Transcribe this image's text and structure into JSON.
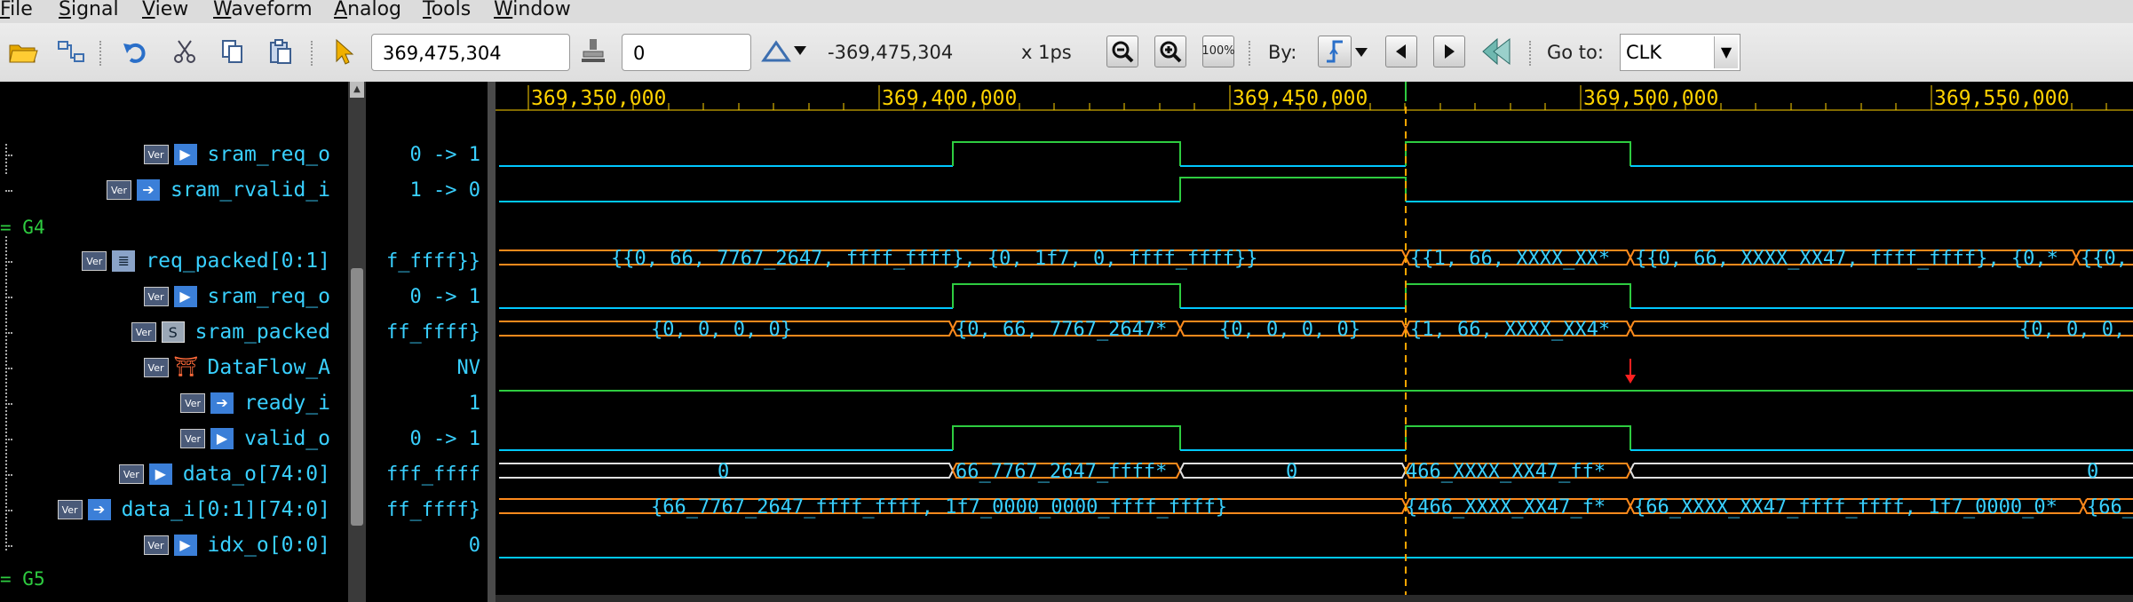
{
  "menu": [
    "File",
    "Signal",
    "View",
    "Waveform",
    "Analog",
    "Tools",
    "Window"
  ],
  "toolbar": {
    "cursor_time": "369,475,304",
    "delta_time": "0",
    "delta_readout": "-369,475,304",
    "scale": "x 1ps",
    "zoom_100": "100%",
    "by_label": "By:",
    "goto_label": "Go to:",
    "goto_value": "CLK"
  },
  "groups": [
    "G4",
    "G5"
  ],
  "signals": [
    {
      "name": "sram_req_o",
      "kind": "out",
      "value": "0 -> 1"
    },
    {
      "name": "sram_rvalid_i",
      "kind": "in",
      "value": "1 -> 0"
    },
    {
      "name": "req_packed[0:1]",
      "kind": "struct",
      "value": "f_ffff}}"
    },
    {
      "name": "sram_req_o",
      "kind": "out",
      "value": "0 -> 1"
    },
    {
      "name": "sram_packed",
      "kind": "s",
      "value": "ff_ffff}"
    },
    {
      "name": "DataFlow_A",
      "kind": "flow",
      "value": "NV"
    },
    {
      "name": "ready_i",
      "kind": "in",
      "value": "1"
    },
    {
      "name": "valid_o",
      "kind": "out",
      "value": "0 -> 1"
    },
    {
      "name": "data_o[74:0]",
      "kind": "out",
      "value": "fff_ffff"
    },
    {
      "name": "data_i[0:1][74:0]",
      "kind": "in",
      "value": "ff_ffff}"
    },
    {
      "name": "idx_o[0:0]",
      "kind": "out",
      "value": "0"
    }
  ],
  "ruler": [
    "369,350,000",
    "369,400,000",
    "369,450,000",
    "369,500,000",
    "369,550,000"
  ],
  "bus_text": {
    "req_packed": [
      "{{0, 66, 7767_2647, ffff_ffff}, {0, 1f7, 0, ffff_ffff}}",
      "{{1, 66, XXXX_XX*",
      "{{0, 66, XXXX_XX47, ffff_ffff}, {0,*",
      "{{0,"
    ],
    "sram_packed": [
      "{0, 0, 0, 0}",
      "{0, 66, 7767_2647*",
      "{0, 0, 0, 0}",
      "{1, 66, XXXX_XX4*",
      "{0, 0, 0,"
    ],
    "data_o": [
      "0",
      "66_7767_2647_ffff*",
      "0",
      "466_XXXX_XX47_ff*",
      "0"
    ],
    "data_i": [
      "{66_7767_2647_ffff_ffff, 1f7_0000_0000_ffff_ffff}",
      "{466_XXXX_XX47_f*",
      "{66_XXXX_XX47_ffff_ffff, 1f7_0000_0*",
      "{66_"
    ]
  },
  "colors": {
    "wave": "#00c8ff",
    "high": "#2ecc40",
    "bus_edge": "#ff8a1c",
    "bus_line": "#e0e0e0",
    "cursor": "#ffa500",
    "marker": "#ff2020",
    "ruler_text": "#ffd200"
  },
  "icons": [
    "folder-open-icon",
    "hierarchy-icon",
    "undo-icon",
    "cut-icon",
    "copy-icon",
    "paste-icon",
    "pointer-icon",
    "stamp-icon",
    "delta-icon",
    "zoom-out-icon",
    "zoom-in-icon",
    "zoom-100-icon",
    "edge-search-icon",
    "prev-icon",
    "next-icon",
    "back-icon"
  ]
}
